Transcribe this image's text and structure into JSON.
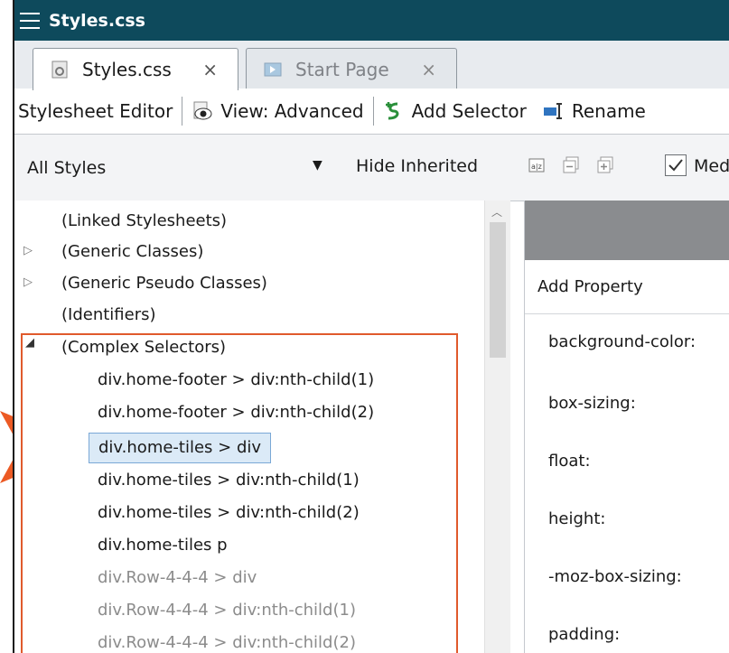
{
  "window": {
    "title": "Styles.css"
  },
  "tabs": [
    {
      "label": "Styles.css",
      "close": "×",
      "active": true
    },
    {
      "label": "Start Page",
      "close": "×",
      "active": false
    }
  ],
  "toolbar": {
    "editor_label": "Stylesheet Editor",
    "view_label": "View: Advanced",
    "add_selector_label": "Add Selector",
    "rename_label": "Rename"
  },
  "filter": {
    "selected": "All Styles",
    "hide_inherited": "Hide Inherited",
    "checkbox_label": "Med"
  },
  "tree": {
    "linked": "(Linked Stylesheets)",
    "generic_classes": "(Generic Classes)",
    "generic_pseudo": "(Generic Pseudo Classes)",
    "identifiers": "(Identifiers)",
    "complex": "(Complex Selectors)",
    "selectors": [
      "div.home-footer > div:nth-child(1)",
      "div.home-footer > div:nth-child(2)",
      "div.home-tiles > div",
      "div.home-tiles > div:nth-child(1)",
      "div.home-tiles > div:nth-child(2)",
      "div.home-tiles p",
      "div.Row-4-4-4 > div",
      "div.Row-4-4-4 > div:nth-child(1)",
      "div.Row-4-4-4 > div:nth-child(2)"
    ],
    "selected_index": 2
  },
  "properties": {
    "add_label": "Add Property",
    "items": [
      "background-color:",
      "box-sizing:",
      "float:",
      "height:",
      "-moz-box-sizing:",
      "padding:"
    ]
  },
  "colors": {
    "titlebar": "#0e4a5c",
    "highlight_box": "#e05a2c",
    "selection": "#dbeaf7"
  }
}
